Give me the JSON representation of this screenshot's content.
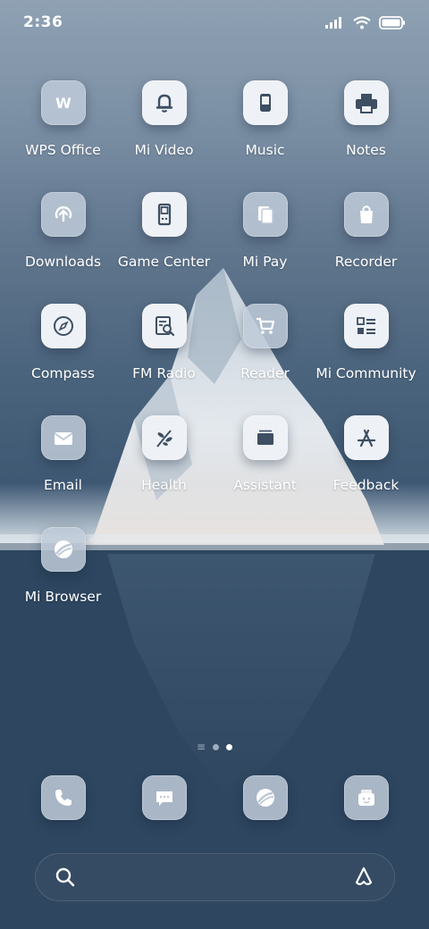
{
  "status_bar": {
    "time": "2:36"
  },
  "colors": {
    "icon_glyph": "#3e4f63",
    "icon_light_bg": "#eef1f6",
    "icon_frost_bg": "#bec9d6",
    "active_dot": "#ffffff",
    "inactive_dot": "#9eaebe"
  },
  "home": {
    "apps": [
      {
        "label": "WPS Office",
        "icon": "wps-icon"
      },
      {
        "label": "Mi Video",
        "icon": "bell-icon"
      },
      {
        "label": "Music",
        "icon": "phone-device-icon"
      },
      {
        "label": "Notes",
        "icon": "printer-icon"
      },
      {
        "label": "Downloads",
        "icon": "upload-arrow-icon"
      },
      {
        "label": "Game Center",
        "icon": "gameboy-icon"
      },
      {
        "label": "Mi Pay",
        "icon": "documents-icon"
      },
      {
        "label": "Recorder",
        "icon": "shopping-bag-icon"
      },
      {
        "label": "Compass",
        "icon": "compass-icon"
      },
      {
        "label": "FM Radio",
        "icon": "document-search-icon"
      },
      {
        "label": "Reader",
        "icon": "cart-icon"
      },
      {
        "label": "Mi Community",
        "icon": "list-icon"
      },
      {
        "label": "Email",
        "icon": "mail-icon"
      },
      {
        "label": "Health",
        "icon": "leaf-branch-icon"
      },
      {
        "label": "Assistant",
        "icon": "folder-stack-icon"
      },
      {
        "label": "Feedback",
        "icon": "app-store-icon"
      },
      {
        "label": "Mi Browser",
        "icon": "planet-icon"
      }
    ]
  },
  "page_indicator": {
    "menu_glyph": "≡",
    "pages": 2,
    "active_page": 2
  },
  "dock": [
    {
      "icon": "phone-icon"
    },
    {
      "icon": "message-icon"
    },
    {
      "icon": "planet-icon"
    },
    {
      "icon": "gallery-icon"
    }
  ],
  "search": {
    "icon": "search-icon",
    "assistant_icon": "assistant-icon"
  }
}
